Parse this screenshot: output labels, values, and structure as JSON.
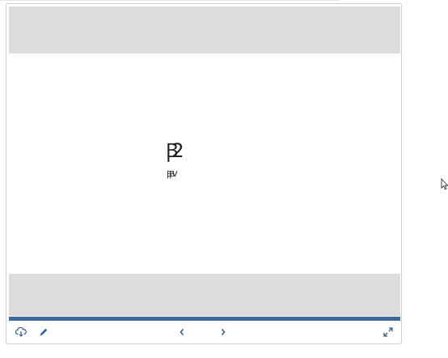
{
  "slide": {
    "title_glyph": "Ꞵ2",
    "subtitle_glyph": "ꞴꞴV"
  },
  "progress": {
    "fraction": 1.0,
    "color": "#3d6a9a"
  },
  "toolbar": {
    "icons": [
      "cloud-download-icon",
      "pencil-icon",
      "chevron-left-icon",
      "chevron-right-icon",
      "expand-icon"
    ]
  },
  "colors": {
    "band": "#dcdcdc",
    "icon": "#2f5d8a"
  }
}
